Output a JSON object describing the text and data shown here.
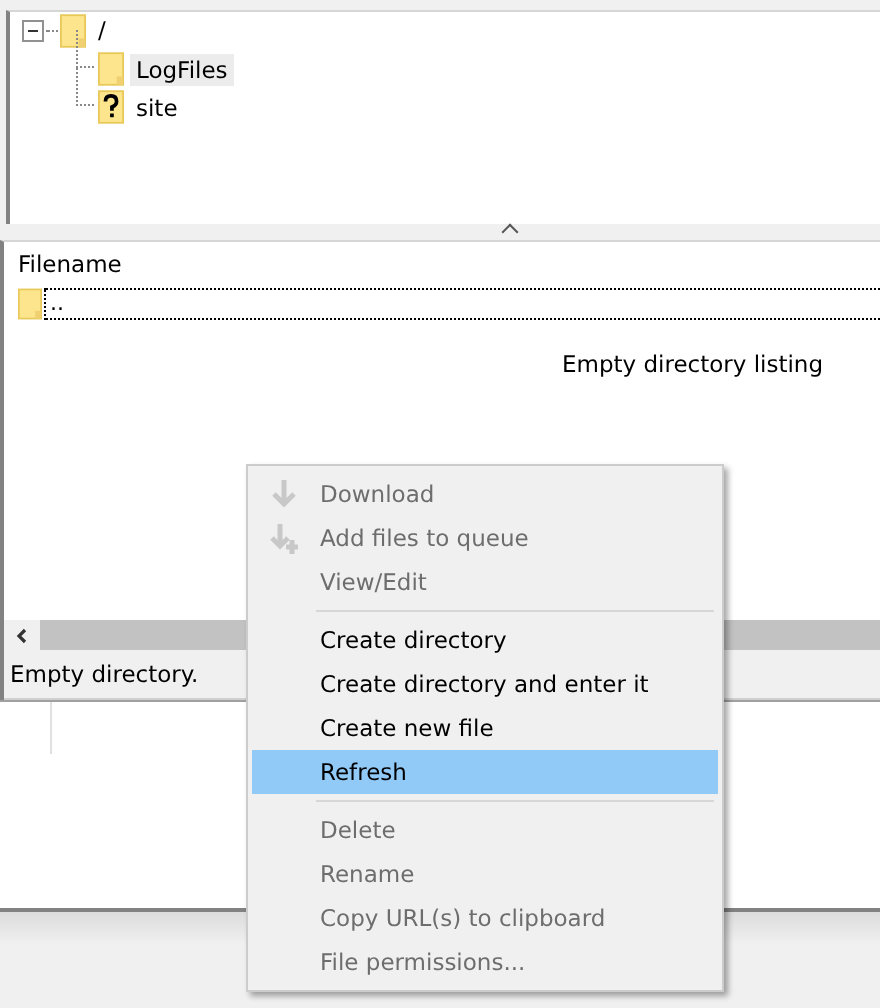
{
  "tree": {
    "label": "/",
    "expanded": true,
    "kind": "folder",
    "selected": false,
    "children": [
      {
        "label": "LogFiles",
        "kind": "folder",
        "selected": true
      },
      {
        "label": "site",
        "kind": "unknown",
        "selected": false
      }
    ]
  },
  "file_list": {
    "columns": [
      "Filename"
    ],
    "rows": [
      {
        "name": "..",
        "focused": true
      }
    ],
    "empty_message": "Empty directory listing"
  },
  "status_bar": "Empty directory.",
  "context_menu": [
    {
      "kind": "item",
      "label": "Download",
      "disabled": true,
      "selected": false
    },
    {
      "kind": "item",
      "label": "Add files to queue",
      "disabled": true,
      "selected": false
    },
    {
      "kind": "item",
      "label": "View/Edit",
      "disabled": true,
      "selected": false
    },
    {
      "kind": "separator"
    },
    {
      "kind": "item",
      "label": "Create directory",
      "disabled": false,
      "selected": false
    },
    {
      "kind": "item",
      "label": "Create directory and enter it",
      "disabled": false,
      "selected": false
    },
    {
      "kind": "item",
      "label": "Create new file",
      "disabled": false,
      "selected": false
    },
    {
      "kind": "item",
      "label": "Refresh",
      "disabled": false,
      "selected": true
    },
    {
      "kind": "separator"
    },
    {
      "kind": "item",
      "label": "Delete",
      "disabled": true,
      "selected": false
    },
    {
      "kind": "item",
      "label": "Rename",
      "disabled": true,
      "selected": false
    },
    {
      "kind": "item",
      "label": "Copy URL(s) to clipboard",
      "disabled": true,
      "selected": false
    },
    {
      "kind": "item",
      "label": "File permissions...",
      "disabled": true,
      "selected": false
    }
  ]
}
